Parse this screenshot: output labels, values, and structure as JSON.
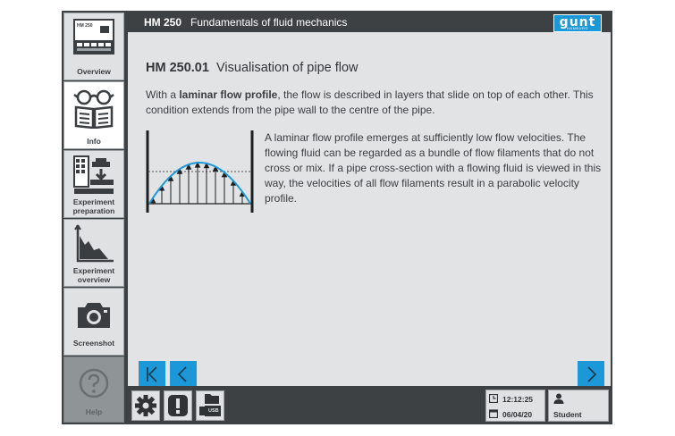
{
  "sidebar": {
    "items": [
      {
        "label": "Overview",
        "icon": "device-icon"
      },
      {
        "label": "Info",
        "icon": "glasses-book-icon"
      },
      {
        "label": "Experiment preparation",
        "icon": "setup-icon"
      },
      {
        "label": "Experiment overview",
        "icon": "chart-icon"
      },
      {
        "label": "Screenshot",
        "icon": "camera-icon"
      },
      {
        "label": "Help",
        "icon": "question-icon"
      }
    ],
    "device_label": "HM 250"
  },
  "header": {
    "code": "HM 250",
    "title": "Fundamentals of fluid mechanics",
    "logo_text": "gunt",
    "logo_sub": "HAMBURG"
  },
  "page": {
    "code": "HM 250.01",
    "title": "Visualisation of pipe flow",
    "para1_before": "With a ",
    "para1_bold": "laminar flow profile",
    "para1_after": ", the flow is described in layers that slide on top of each other. This condition extends from the pipe wall to the centre of the pipe.",
    "para2": "A laminar flow profile emerges at sufficiently low flow velocities. The flowing fluid can be regarded as a bundle of flow filaments that do not cross or mix. If a pipe cross-section with a flowing fluid is viewed in this way, the velocities of all flow filaments result in a parabolic velocity profile."
  },
  "nav": {
    "first": "first-page-icon",
    "prev": "previous-page-icon",
    "next": "next-page-icon"
  },
  "footer": {
    "time": "12:12:25",
    "date": "06/04/20",
    "user": "Student",
    "usb_label": "USB"
  },
  "colors": {
    "accent": "#1c98d8",
    "frame": "#3d4143",
    "content_bg": "#e2e3e4"
  }
}
